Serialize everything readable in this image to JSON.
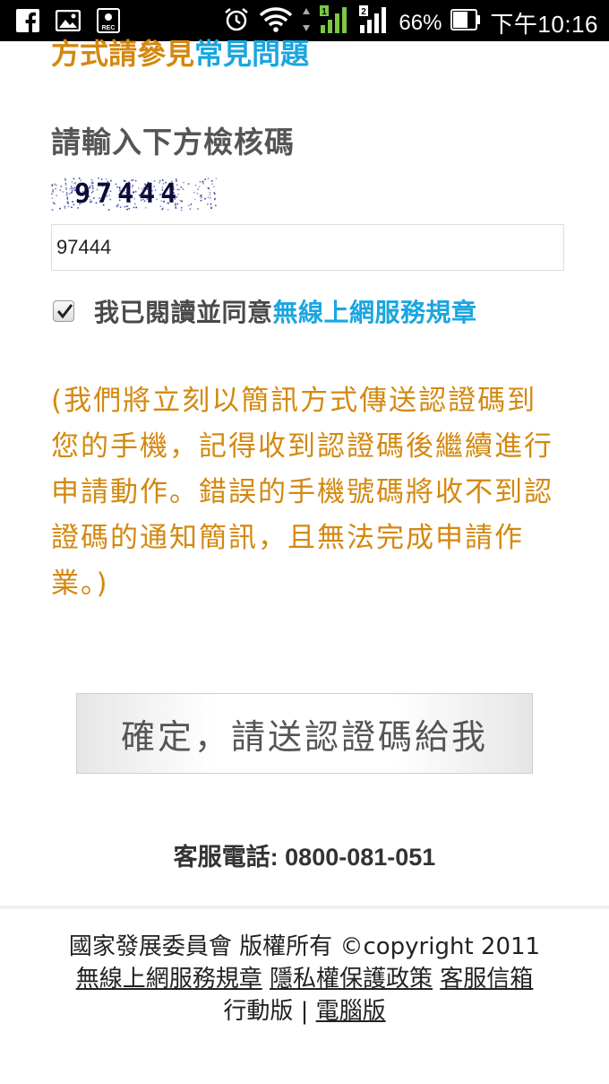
{
  "status_bar": {
    "battery_percent": "66%",
    "time": "下午10:16",
    "sim1": "1",
    "sim2": "2",
    "icons": [
      "facebook-icon",
      "gallery-icon",
      "rec-icon",
      "alarm-icon",
      "wifi-icon",
      "signal-icon",
      "battery-icon"
    ],
    "battery_level": 0.66
  },
  "top_partial": {
    "text": "方式請參見",
    "link": "常見問題"
  },
  "captcha": {
    "title": "請輸入下方檢核碼",
    "image_text": "97444",
    "input_value": "97444"
  },
  "agreement": {
    "checked": true,
    "text": "我已閱讀並同意",
    "link": "無線上網服務規章"
  },
  "notice": "(我們將立刻以簡訊方式傳送認證碼到您的手機，記得收到認證碼後繼續進行申請動作。錯誤的手機號碼將收不到認證碼的通知簡訊，且無法完成申請作業。)",
  "submit_button": "確定，請送認證碼給我",
  "hotline": "客服電話: 0800-081-051",
  "footer": {
    "copyright": "國家發展委員會 版權所有 ©copyright 2011",
    "links": [
      "無線上網服務規章",
      "隱私權保護政策",
      "客服信箱"
    ],
    "mobile_label": "行動版",
    "separator": "|",
    "desktop_link": "電腦版"
  },
  "colors": {
    "orange": "#d4880f",
    "link_blue": "#1aa6e0",
    "signal_green": "#7ac943"
  }
}
